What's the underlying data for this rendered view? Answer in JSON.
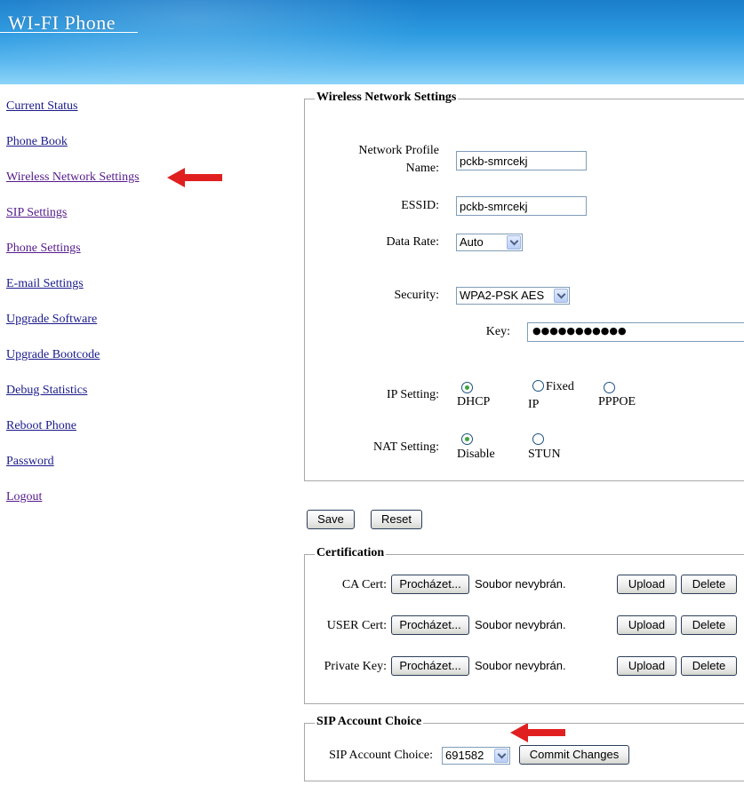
{
  "header": {
    "title": "WI-FI Phone"
  },
  "sidebar": {
    "items": [
      {
        "label": "Current Status"
      },
      {
        "label": "Phone Book"
      },
      {
        "label": "Wireless Network Settings"
      },
      {
        "label": "SIP Settings"
      },
      {
        "label": "Phone Settings"
      },
      {
        "label": "E-mail Settings"
      },
      {
        "label": "Upgrade Software"
      },
      {
        "label": "Upgrade Bootcode"
      },
      {
        "label": "Debug Statistics"
      },
      {
        "label": "Reboot Phone"
      },
      {
        "label": "Password"
      },
      {
        "label": "Logout"
      }
    ]
  },
  "wireless": {
    "legend": "Wireless Network Settings",
    "profile_label_1": "Network Profile",
    "profile_label_2": "Name:",
    "profile_value": "pckb-smrcekj",
    "essid_label": "ESSID:",
    "essid_value": "pckb-smrcekj",
    "rate_label": "Data Rate:",
    "rate_value": "Auto",
    "security_label": "Security:",
    "security_value": "WPA2-PSK AES",
    "key_label": "Key:",
    "key_masked": "●●●●●●●●●●●",
    "ip_label": "IP Setting:",
    "ip_options": [
      {
        "label": "DHCP",
        "selected": true
      },
      {
        "label_top": "Fixed",
        "label_bottom": "IP",
        "selected": false
      },
      {
        "label": "PPPOE",
        "selected": false
      }
    ],
    "nat_label": "NAT Setting:",
    "nat_options": [
      {
        "label": "Disable",
        "selected": true
      },
      {
        "label": "STUN",
        "selected": false
      }
    ]
  },
  "actions": {
    "save": "Save",
    "reset": "Reset"
  },
  "certification": {
    "legend": "Certification",
    "rows": [
      {
        "label": "CA Cert:",
        "browse": "Procházet...",
        "file_status": "Soubor nevybrán.",
        "upload": "Upload",
        "delete": "Delete"
      },
      {
        "label": "USER Cert:",
        "browse": "Procházet...",
        "file_status": "Soubor nevybrán.",
        "upload": "Upload",
        "delete": "Delete"
      },
      {
        "label": "Private Key:",
        "browse": "Procházet...",
        "file_status": "Soubor nevybrán.",
        "upload": "Upload",
        "delete": "Delete"
      }
    ]
  },
  "sip_choice": {
    "legend": "SIP Account Choice",
    "label": "SIP Account Choice:",
    "value": "691582",
    "commit": "Commit Changes"
  },
  "colors": {
    "header_top": "#1a7ecb",
    "header_bottom": "#8dd4f8",
    "link": "#1a1a8c",
    "visited_link": "#551a8b",
    "arrow": "#e02020",
    "radio_dot": "#3ea43e"
  },
  "icons": {
    "annotation_arrow": "red-arrow-icon"
  }
}
